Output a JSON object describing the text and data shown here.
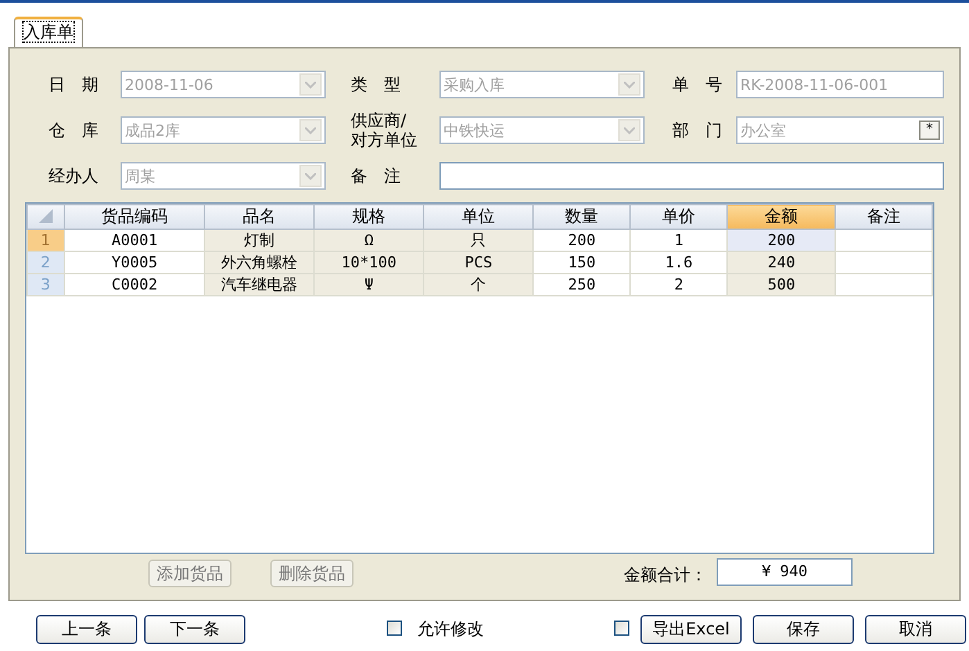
{
  "tabs": [
    {
      "label": "入库单",
      "selected": true
    }
  ],
  "form": [
    {
      "label": "日　期",
      "kind": "combo",
      "value": "2008-11-06",
      "disabled": true
    },
    {
      "label": "类　型",
      "kind": "combo",
      "value": "采购入库",
      "disabled": true
    },
    {
      "label": "单　号",
      "kind": "text",
      "value": "RK-2008-11-06-001",
      "disabled": true
    },
    {
      "label": "仓　库",
      "kind": "combo",
      "value": "成品2库",
      "disabled": true
    },
    {
      "label": "供应商/\n对方单位",
      "kind": "combo",
      "value": "中铁快运",
      "disabled": true
    },
    {
      "label": "部　门",
      "kind": "picker",
      "value": "办公室",
      "button": "*",
      "disabled": true
    },
    {
      "label": "经办人",
      "kind": "combo",
      "value": "周某",
      "disabled": true
    },
    {
      "label": "备　注",
      "kind": "wide",
      "disabled": false
    }
  ],
  "table": {
    "columns": [
      {
        "label": "货品编码",
        "readonly": false,
        "selected": false
      },
      {
        "label": "品名",
        "readonly": true,
        "selected": false
      },
      {
        "label": "规格",
        "readonly": true,
        "selected": false
      },
      {
        "label": "单位",
        "readonly": true,
        "selected": false
      },
      {
        "label": "数量",
        "readonly": false,
        "selected": false
      },
      {
        "label": "单价",
        "readonly": false,
        "selected": false
      },
      {
        "label": "金额",
        "readonly": true,
        "selected": true
      },
      {
        "label": "备注",
        "readonly": false,
        "selected": false
      }
    ],
    "rows": [
      {
        "number": "1",
        "selected": true,
        "cells": [
          "A0001",
          "灯制",
          "Ω",
          "只",
          "200",
          "1",
          "200",
          ""
        ]
      },
      {
        "number": "2",
        "selected": false,
        "cells": [
          "Y0005",
          "外六角螺栓",
          "10*100",
          "PCS",
          "150",
          "1.6",
          "240",
          ""
        ]
      },
      {
        "number": "3",
        "selected": false,
        "cells": [
          "C0002",
          "汽车继电器",
          "Ψ",
          "个",
          "250",
          "2",
          "500",
          ""
        ]
      }
    ]
  },
  "grid_buttons": [
    {
      "label": "添加货品",
      "disabled": true
    },
    {
      "label": "删除货品",
      "disabled": true
    }
  ],
  "total": {
    "label": "金额合计：",
    "value": "¥ 940"
  },
  "nav_buttons": [
    "上一条",
    "下一条"
  ],
  "allow_edit": {
    "label": "允许修改",
    "checked": false
  },
  "export": {
    "label": "导出Excel",
    "checked": false
  },
  "actions": [
    "保存",
    "取消"
  ]
}
